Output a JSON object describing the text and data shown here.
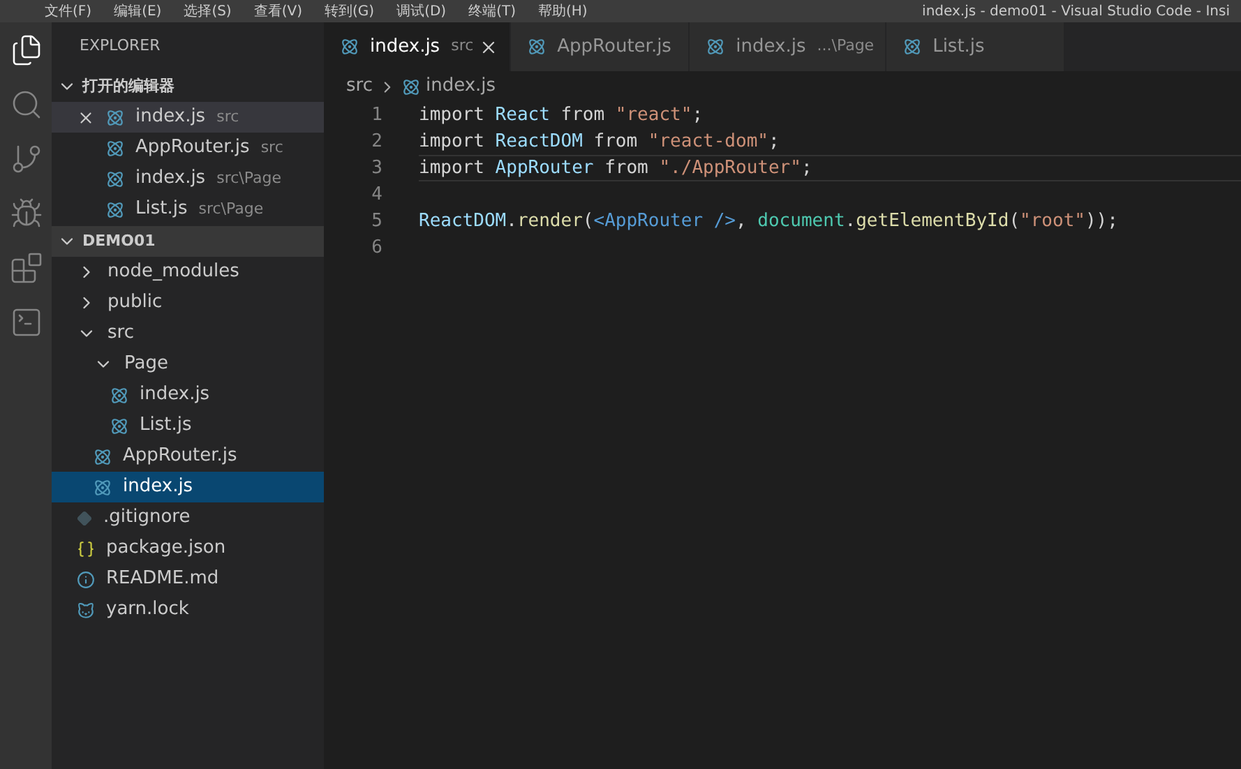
{
  "title_bar": {
    "menu": [
      "文件(F)",
      "编辑(E)",
      "选择(S)",
      "查看(V)",
      "转到(G)",
      "调试(D)",
      "终端(T)",
      "帮助(H)"
    ],
    "title": "index.js - demo01 - Visual Studio Code - Insi"
  },
  "activity_bar": [
    {
      "kind": "files",
      "selected": true
    },
    {
      "kind": "search",
      "selected": false
    },
    {
      "kind": "scm",
      "selected": false
    },
    {
      "kind": "debug",
      "selected": false
    },
    {
      "kind": "extensions",
      "selected": false
    },
    {
      "kind": "terminal",
      "selected": false
    }
  ],
  "sidebar": {
    "title": "EXPLORER",
    "open_editors": {
      "title": "打开的编辑器",
      "expanded": true,
      "items": [
        {
          "name": "index.js",
          "path": "src",
          "selected": true
        },
        {
          "name": "AppRouter.js",
          "path": "src",
          "selected": false
        },
        {
          "name": "index.js",
          "path": "src\\Page",
          "selected": false
        },
        {
          "name": "List.js",
          "path": "src\\Page",
          "selected": false
        }
      ]
    },
    "project": {
      "title": "DEMO01",
      "expanded": true,
      "tree": [
        {
          "name": "node_modules",
          "kind": "folder",
          "expanded": false,
          "selected": false
        },
        {
          "name": "public",
          "kind": "folder",
          "expanded": false,
          "selected": false
        },
        {
          "name": "src",
          "kind": "folder",
          "expanded": true,
          "selected": false,
          "children": [
            {
              "name": "Page",
              "kind": "folder",
              "expanded": true,
              "selected": false,
              "children": [
                {
                  "name": "index.js",
                  "kind": "react",
                  "selected": false
                },
                {
                  "name": "List.js",
                  "kind": "react",
                  "selected": false
                }
              ]
            },
            {
              "name": "AppRouter.js",
              "kind": "react",
              "selected": false
            },
            {
              "name": "index.js",
              "kind": "react",
              "selected": true
            }
          ]
        },
        {
          "name": ".gitignore",
          "kind": "git",
          "selected": false
        },
        {
          "name": "package.json",
          "kind": "json",
          "selected": false
        },
        {
          "name": "README.md",
          "kind": "info",
          "selected": false
        },
        {
          "name": "yarn.lock",
          "kind": "yarn",
          "selected": false
        }
      ]
    }
  },
  "tabs": [
    {
      "name": "index.js",
      "path": "src",
      "selected": true
    },
    {
      "name": "AppRouter.js",
      "selected": false
    },
    {
      "name": "index.js",
      "path": "...\\Page",
      "selected": false
    },
    {
      "name": "List.js",
      "selected": false
    }
  ],
  "breadcrumb": [
    "src",
    "index.js"
  ],
  "code": [
    {
      "number": "1",
      "current": false,
      "tokens": [
        {
          "t": "import ",
          "kind": "kw"
        },
        {
          "t": "React",
          "kind": "var"
        },
        {
          "t": " from ",
          "kind": "kw"
        },
        {
          "t": "\"react\"",
          "kind": "str"
        },
        {
          "t": ";",
          "kind": "plain"
        }
      ]
    },
    {
      "number": "2",
      "current": false,
      "tokens": [
        {
          "t": "import ",
          "kind": "kw"
        },
        {
          "t": "ReactDOM",
          "kind": "var"
        },
        {
          "t": " from ",
          "kind": "kw"
        },
        {
          "t": "\"react-dom\"",
          "kind": "str"
        },
        {
          "t": ";",
          "kind": "plain"
        }
      ]
    },
    {
      "number": "3",
      "current": true,
      "tokens": [
        {
          "t": "import ",
          "kind": "kw"
        },
        {
          "t": "AppRouter",
          "kind": "var"
        },
        {
          "t": " from ",
          "kind": "kw"
        },
        {
          "t": "\"./AppRouter\"",
          "kind": "str"
        },
        {
          "t": ";",
          "kind": "plain"
        }
      ]
    },
    {
      "number": "4",
      "current": false
    },
    {
      "number": "5",
      "current": false,
      "tokens": [
        {
          "t": "ReactDOM",
          "kind": "var"
        },
        {
          "t": ".",
          "kind": "plain"
        },
        {
          "t": "render",
          "kind": "fn"
        },
        {
          "t": "(",
          "kind": "plain"
        },
        {
          "t": "<AppRouter />",
          "kind": "tag"
        },
        {
          "t": ", ",
          "kind": "plain"
        },
        {
          "t": "document",
          "kind": "type"
        },
        {
          "t": ".",
          "kind": "plain"
        },
        {
          "t": "getElementById",
          "kind": "fn"
        },
        {
          "t": "(",
          "kind": "plain"
        },
        {
          "t": "\"root\"",
          "kind": "str"
        },
        {
          "t": "));",
          "kind": "plain"
        }
      ]
    },
    {
      "number": "6",
      "current": false
    }
  ]
}
